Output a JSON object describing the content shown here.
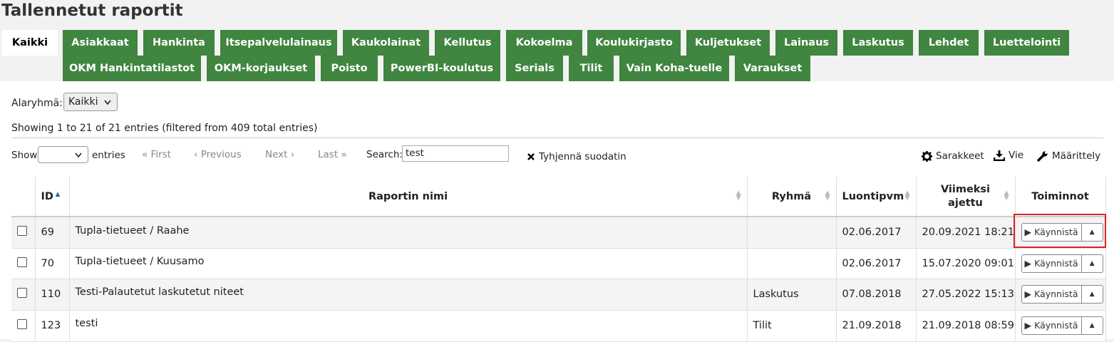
{
  "title": "Tallennetut raportit",
  "tabs_row1": [
    "Kaikki",
    "Asiakkaat",
    "Hankinta",
    "Itsepalvelulainaus",
    "Kaukolainat",
    "Kellutus",
    "Kokoelma",
    "Koulukirjasto",
    "Kuljetukset",
    "Lainaus",
    "Laskutus",
    "Lehdet",
    "Luettelointi"
  ],
  "tabs_row2": [
    "OKM Hankintatilastot",
    "OKM-korjaukset",
    "Poisto",
    "PowerBI-koulutus",
    "Serials",
    "Tilit",
    "Vain Koha-tuelle",
    "Varaukset"
  ],
  "subgroup": {
    "label": "Alaryhmä:",
    "value": "Kaikki"
  },
  "info": "Showing 1 to 21 of 21 entries (filtered from 409 total entries)",
  "pager": {
    "show": "Show",
    "entries": "entries",
    "first": "« First",
    "previous": "‹ Previous",
    "next": "Next ›",
    "last": "Last »"
  },
  "search": {
    "label": "Search:",
    "value": "test"
  },
  "clear_filter": "Tyhjennä suodatin",
  "toolbar": {
    "columns": "Sarakkeet",
    "export": "Vie",
    "configure": "Määrittely"
  },
  "columns": {
    "id": "ID",
    "name": "Raportin nimi",
    "group": "Ryhmä",
    "created": "Luontipvm",
    "last_run": "Viimeksi ajettu",
    "actions": "Toiminnot"
  },
  "run_label": "Käynnistä",
  "rows": [
    {
      "id": "69",
      "name": "Tupla-tietueet / Raahe",
      "group": "",
      "created": "02.06.2017",
      "last_run": "20.09.2021 18:21"
    },
    {
      "id": "70",
      "name": "Tupla-tietueet / Kuusamo",
      "group": "",
      "created": "02.06.2017",
      "last_run": "15.07.2020 09:01"
    },
    {
      "id": "110",
      "name": "Testi-Palautetut laskutetut niteet",
      "group": "Laskutus",
      "created": "07.08.2018",
      "last_run": "27.05.2022 15:13"
    },
    {
      "id": "123",
      "name": "testi",
      "group": "Tilit",
      "created": "21.09.2018",
      "last_run": "21.09.2018 08:59"
    }
  ],
  "colors": {
    "tab_green": "#408540",
    "highlight": "#dd2222"
  }
}
